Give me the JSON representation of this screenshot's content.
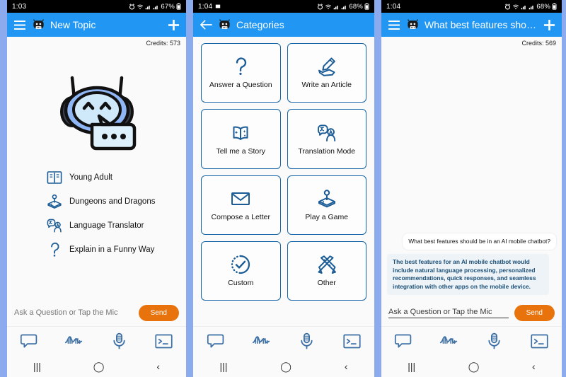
{
  "colors": {
    "outer_background": "#8CAAEE",
    "appbar_blue": "#2196F3",
    "send_orange": "#E8730C",
    "card_border": "#1565A8",
    "icon_blue": "#1B5C96",
    "bot_text": "#1B4F77"
  },
  "screens": [
    {
      "id": "new-topic",
      "status": {
        "time": "1:03",
        "battery": "67%"
      },
      "appbar": {
        "left_icon": "hamburger-menu-icon",
        "title": "New Topic",
        "right_icon": "plus-icon"
      },
      "credits": "Credits: 573",
      "mascot": "chatbot-robot-mascot",
      "menu": [
        {
          "icon": "open-book-icon",
          "label": "Young Adult"
        },
        {
          "icon": "joystick-icon",
          "label": "Dungeons and Dragons"
        },
        {
          "icon": "translate-icon",
          "label": "Language Translator"
        },
        {
          "icon": "question-mark-icon",
          "label": "Explain in a Funny Way"
        }
      ],
      "input": {
        "placeholder": "Ask a Question or Tap the Mic",
        "value": "",
        "focused": false
      },
      "send_label": "Send",
      "toolbar": [
        "chat-bubble-icon",
        "sound-wave-icon",
        "microphone-icon",
        "terminal-icon"
      ],
      "nav": [
        "recents-icon",
        "home-icon",
        "back-icon"
      ]
    },
    {
      "id": "categories",
      "status": {
        "time": "1:04",
        "battery": "68%"
      },
      "appbar": {
        "left_icon": "back-arrow-icon",
        "title": "Categories",
        "right_icon": ""
      },
      "cards": [
        {
          "icon": "question-mark-icon",
          "label": "Answer a Question"
        },
        {
          "icon": "writing-hand-icon",
          "label": "Write an Article"
        },
        {
          "icon": "open-book-sparkle-icon",
          "label": "Tell me a Story"
        },
        {
          "icon": "translate-icon",
          "label": "Translation Mode"
        },
        {
          "icon": "envelope-icon",
          "label": "Compose a Letter"
        },
        {
          "icon": "joystick-icon",
          "label": "Play a Game"
        },
        {
          "icon": "check-circle-dotted-icon",
          "label": "Custom"
        },
        {
          "icon": "pencil-ruler-icon",
          "label": "Other"
        }
      ],
      "toolbar": [
        "chat-bubble-icon",
        "sound-wave-icon",
        "microphone-icon",
        "terminal-icon"
      ],
      "nav": [
        "recents-icon",
        "home-icon",
        "back-icon"
      ]
    },
    {
      "id": "chat",
      "status": {
        "time": "1:04",
        "battery": "68%"
      },
      "appbar": {
        "left_icon": "hamburger-menu-icon",
        "title": "What best features sho…",
        "right_icon": "plus-icon"
      },
      "credits": "Credits: 569",
      "messages": [
        {
          "role": "user",
          "text": "What best features should be in an AI mobile chatbot?"
        },
        {
          "role": "bot",
          "text": "The best features for an AI mobile chatbot would include natural language processing, personalized recommendations, quick responses, and seamless integration with other apps on the mobile device."
        }
      ],
      "input": {
        "placeholder": "Ask a Question or Tap the Mic",
        "value": "Ask a Question or Tap the Mic",
        "focused": true
      },
      "send_label": "Send",
      "toolbar": [
        "chat-bubble-icon",
        "sound-wave-icon",
        "microphone-icon",
        "terminal-icon"
      ],
      "nav": [
        "recents-icon",
        "home-icon",
        "back-icon"
      ]
    }
  ]
}
